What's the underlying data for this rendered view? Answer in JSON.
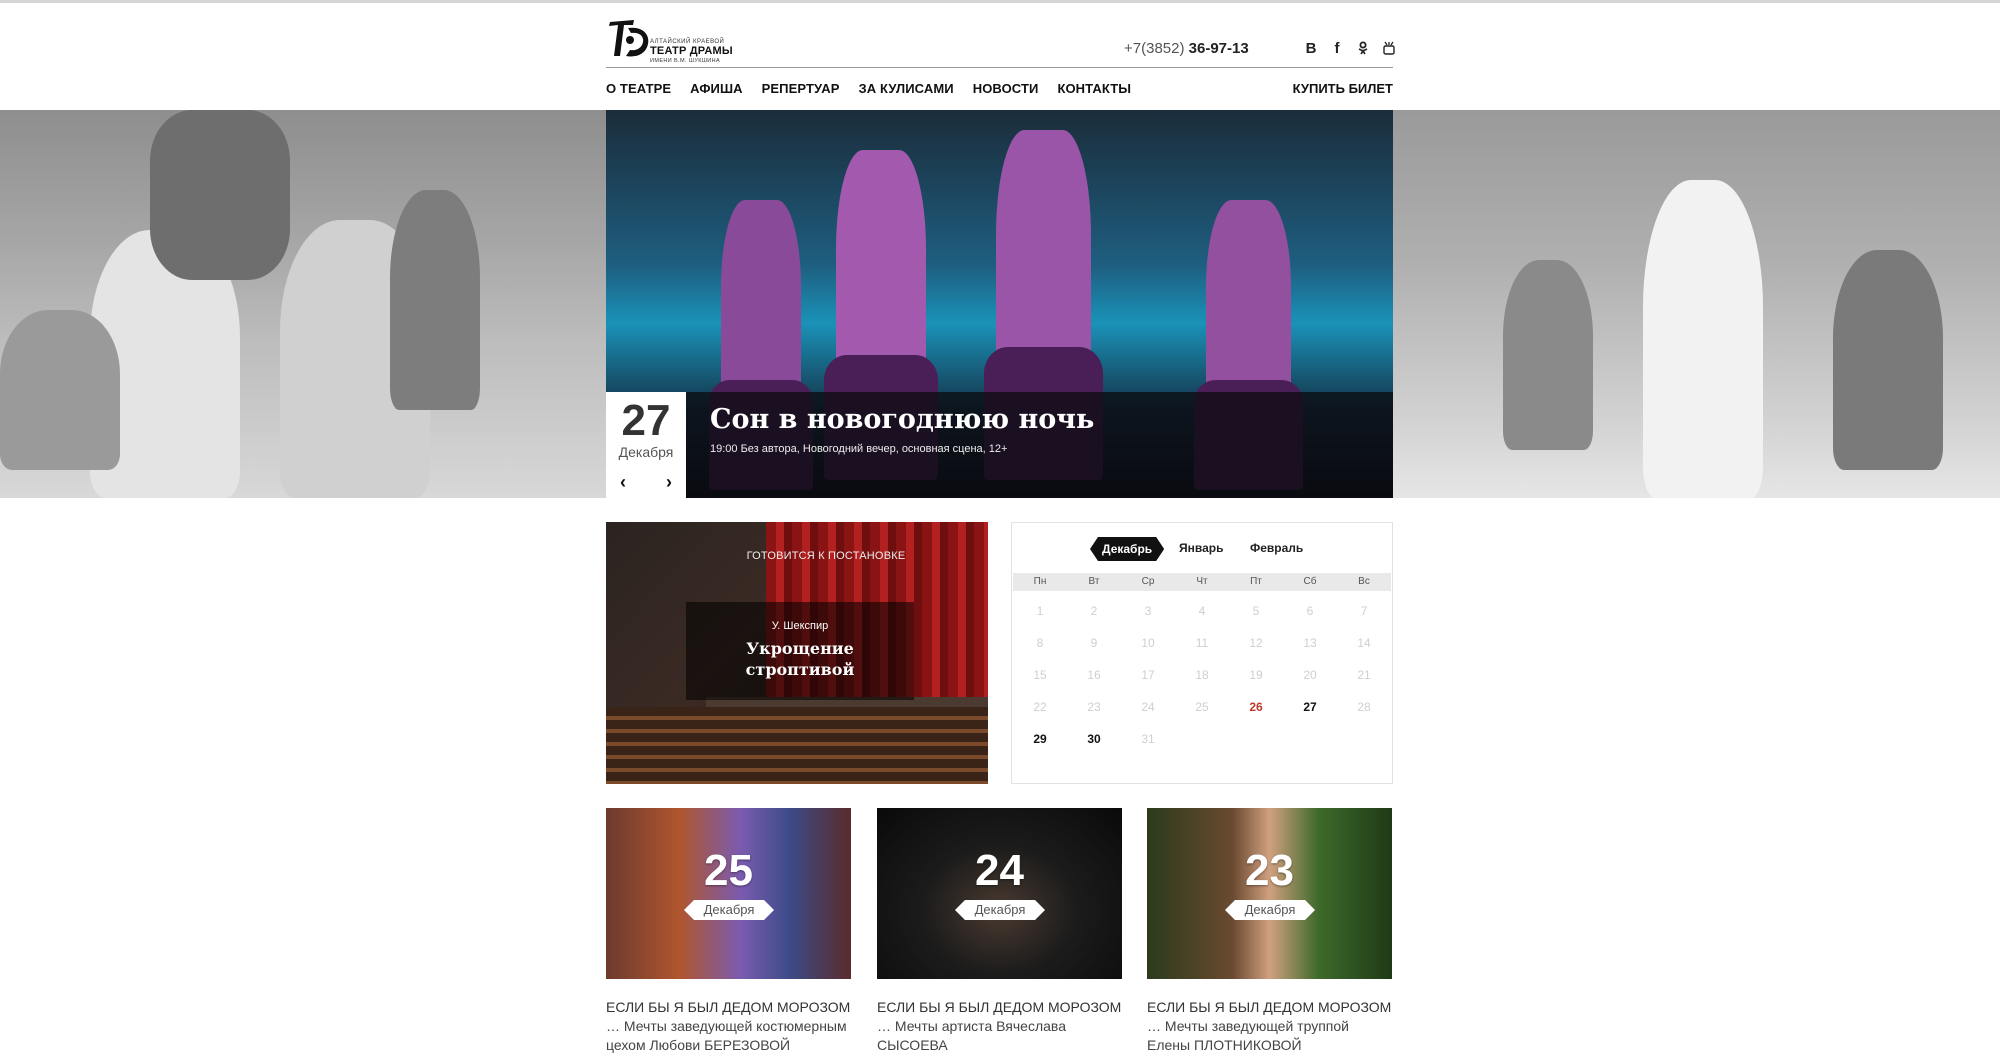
{
  "header": {
    "logo": {
      "small": "АЛТАЙСКИЙ КРАЕВОЙ",
      "big": "ТЕАТР ДРАМЫ",
      "sub": "ИМЕНИ В.М. ШУКШИНА"
    },
    "phone_prefix": "+7(3852)",
    "phone_number": "36-97-13",
    "social": [
      "В",
      "f",
      "ok-icon",
      "youtube-icon"
    ],
    "nav": [
      "О ТЕАТРЕ",
      "АФИША",
      "РЕПЕРТУАР",
      "ЗА КУЛИСАМИ",
      "НОВОСТИ",
      "КОНТАКТЫ"
    ],
    "buy_ticket": "КУПИТЬ БИЛЕТ"
  },
  "hero": {
    "day": "27",
    "month": "Декабря",
    "title": "Сон в новогоднюю ночь",
    "meta": "19:00 Без автора, Новогодний вечер, основная сцена, 12+",
    "prev_icon": "chevron-left-icon",
    "next_icon": "chevron-right-icon"
  },
  "prep": {
    "label": "ГОТОВИТСЯ К ПОСТАНОВКЕ",
    "author": "У. Шекспир",
    "play_line1": "Укрощение",
    "play_line2": "строптивой"
  },
  "calendar": {
    "months": [
      "Декабрь",
      "Январь",
      "Февраль"
    ],
    "active_month": "Декабрь",
    "weekdays": [
      "Пн",
      "Вт",
      "Ср",
      "Чт",
      "Пт",
      "Сб",
      "Вс"
    ],
    "days": [
      "1",
      "2",
      "3",
      "4",
      "5",
      "6",
      "7",
      "8",
      "9",
      "10",
      "11",
      "12",
      "13",
      "14",
      "15",
      "16",
      "17",
      "18",
      "19",
      "20",
      "21",
      "22",
      "23",
      "24",
      "25",
      "26",
      "27",
      "28",
      "29",
      "30",
      "31"
    ],
    "highlight_red": "26",
    "highlight_active": [
      "27",
      "29",
      "30"
    ]
  },
  "news": [
    {
      "day": "25",
      "month": "Декабря",
      "head": "ЕСЛИ БЫ Я БЫЛ ДЕДОМ МОРОЗОМ",
      "body": "… Мечты заведующей костюмерным цехом Любови БЕРЕЗОВОЙ"
    },
    {
      "day": "24",
      "month": "Декабря",
      "head": "ЕСЛИ БЫ Я БЫЛ ДЕДОМ МОРОЗОМ",
      "body": "… Мечты артиста Вячеслава СЫСОЕВА"
    },
    {
      "day": "23",
      "month": "Декабря",
      "head": "ЕСЛИ БЫ Я БЫЛ ДЕДОМ МОРОЗОМ",
      "body": "… Мечты заведующей труппой Елены ПЛОТНИКОВОЙ"
    }
  ],
  "colors": {
    "accent_red": "#c0392b",
    "dark": "#111111",
    "curtain": "#b32020"
  }
}
